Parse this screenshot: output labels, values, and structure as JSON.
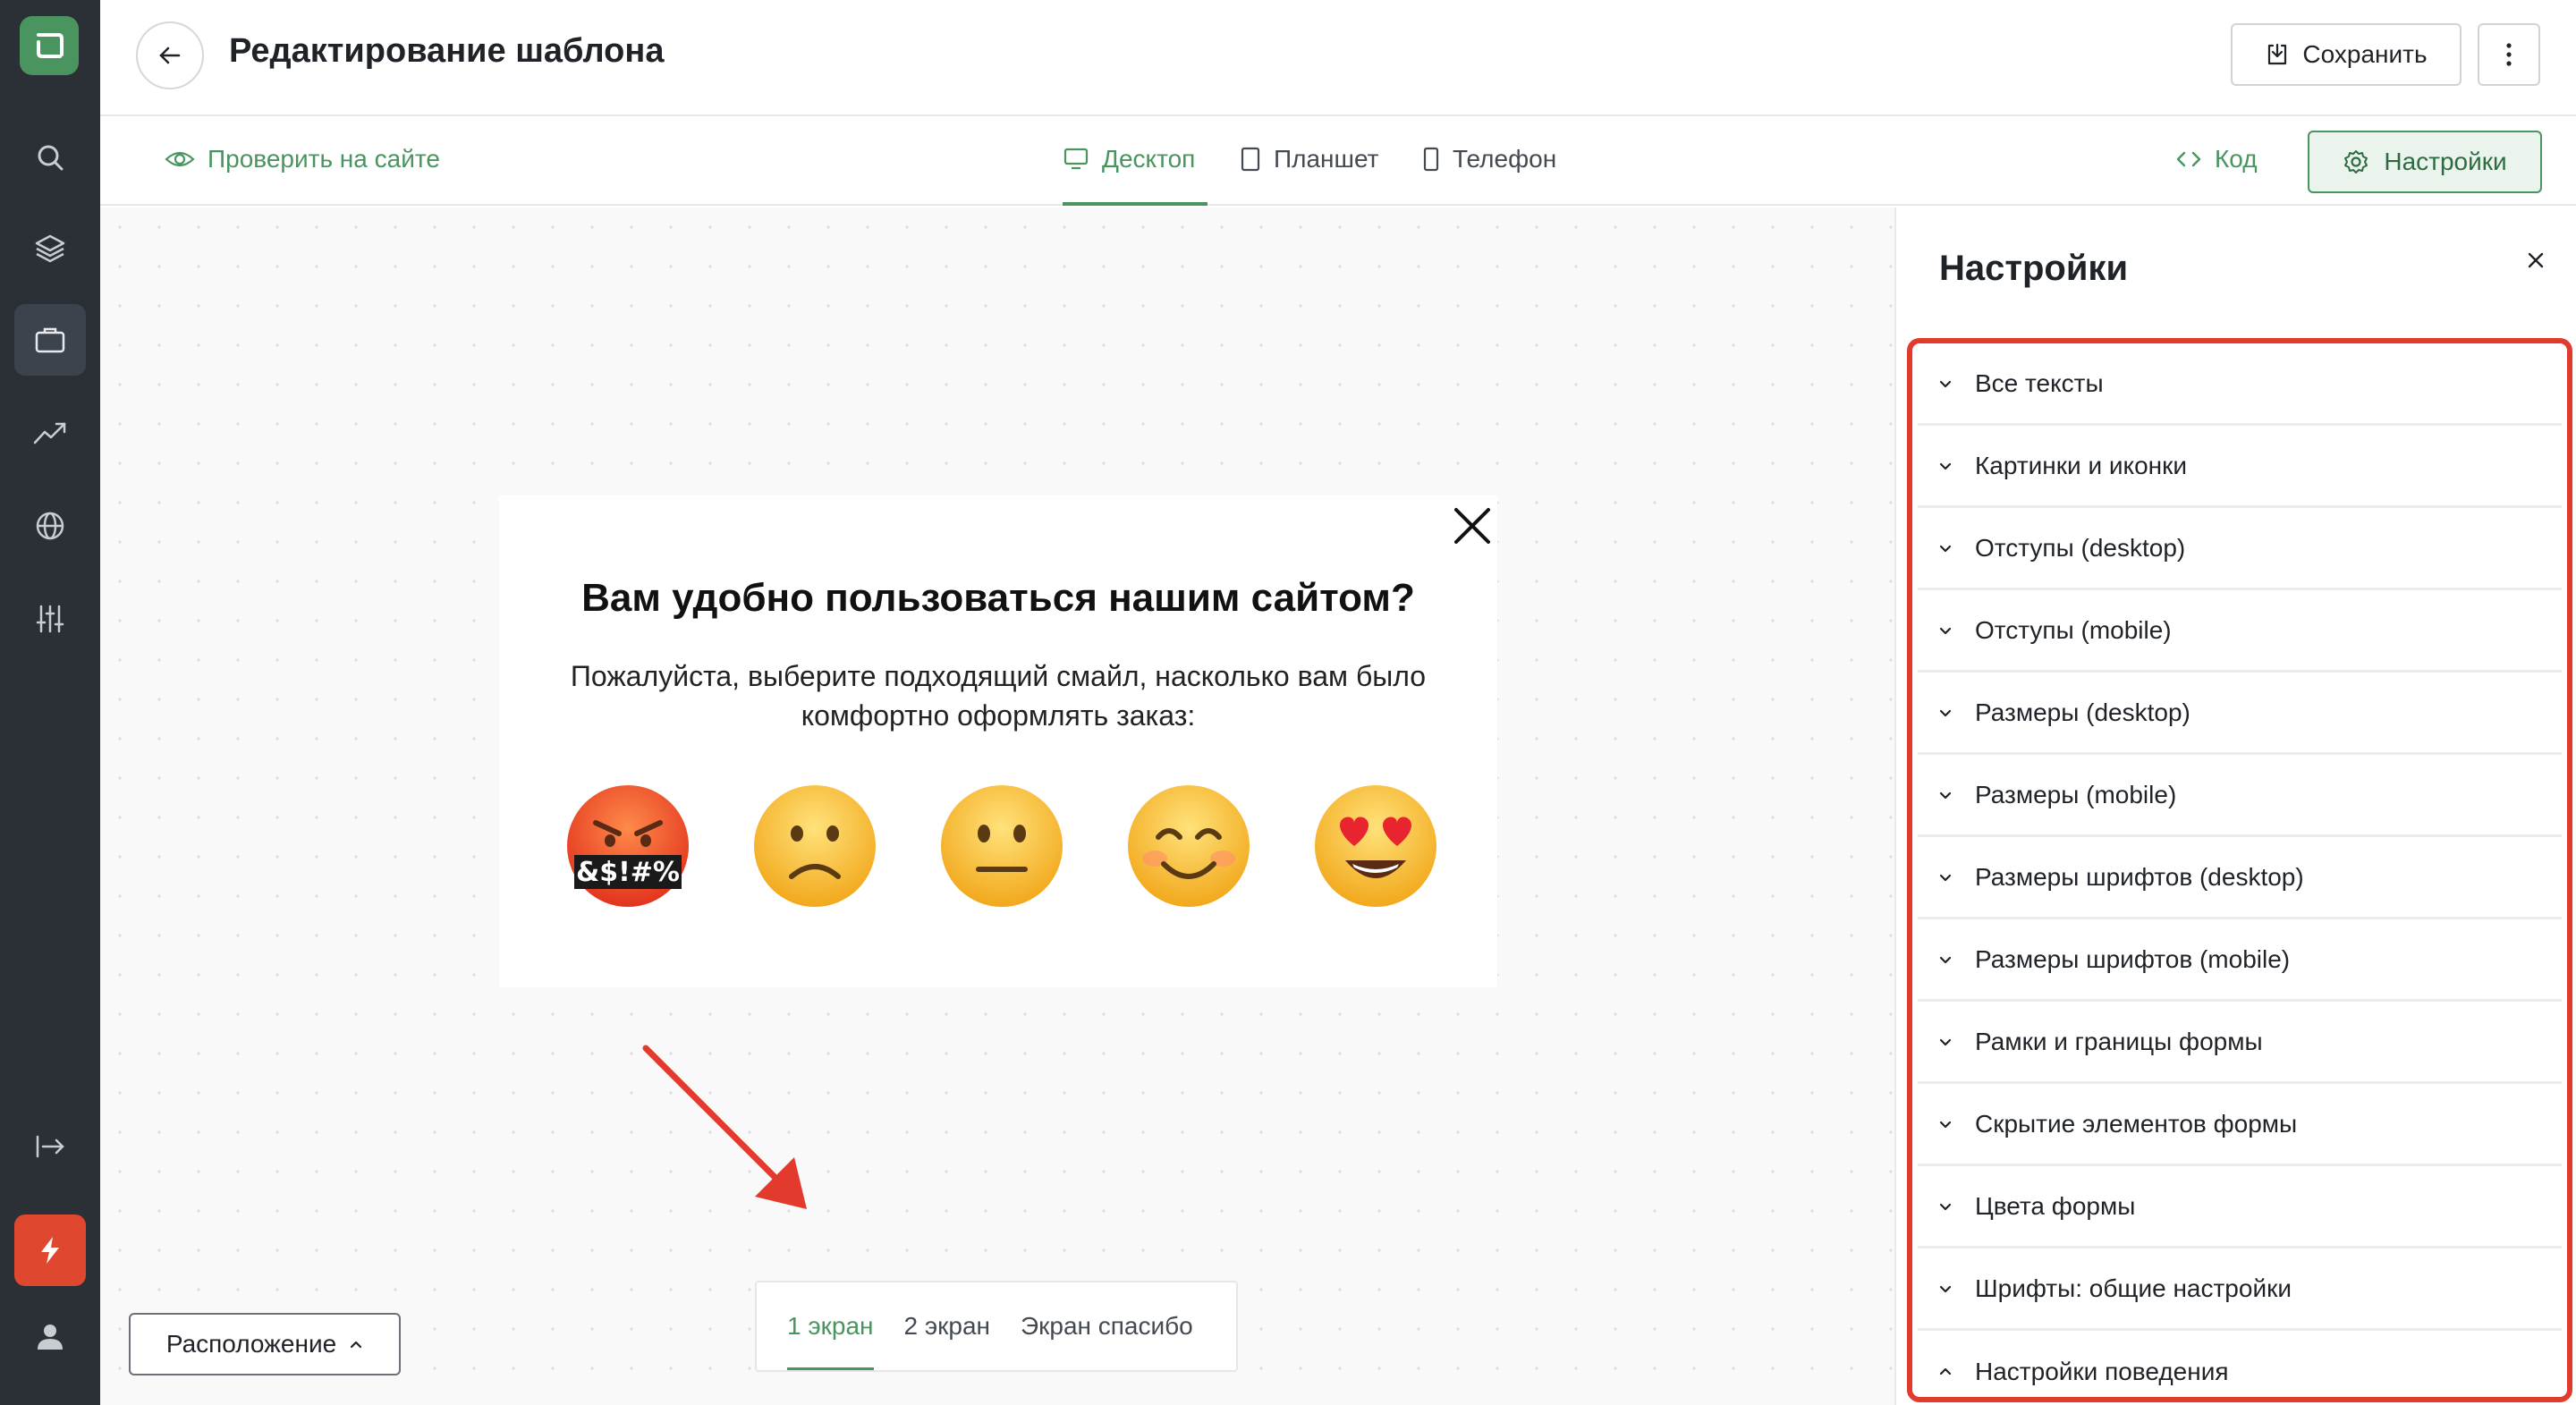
{
  "header": {
    "title": "Редактирование шаблона",
    "save_label": "Сохранить"
  },
  "toolbar": {
    "check_site": "Проверить на сайте",
    "devices": [
      "Десктоп",
      "Планшет",
      "Телефон"
    ],
    "active_device": "Десктоп",
    "code_label": "Код",
    "settings_label": "Настройки"
  },
  "popup": {
    "title": "Вам удобно пользоваться нашим сайтом?",
    "text": "Пожалуйста, выберите подходящий смайл, насколько вам было комфортно оформлять заказ:",
    "emoji_censor_text": "&$!#%",
    "emojis": [
      "angry-cursing-emoji",
      "frowning-emoji",
      "neutral-emoji",
      "smiling-emoji",
      "heart-eyes-emoji"
    ]
  },
  "screens": {
    "tabs": [
      "1 экран",
      "2 экран",
      "Экран спасибо"
    ],
    "active": "1 экран"
  },
  "position_label": "Расположение",
  "panel": {
    "title": "Настройки",
    "items": [
      "Все тексты",
      "Картинки и иконки",
      "Отступы (desktop)",
      "Отступы (mobile)",
      "Размеры (desktop)",
      "Размеры (mobile)",
      "Размеры шрифтов (desktop)",
      "Размеры шрифтов (mobile)",
      "Рамки и границы формы",
      "Скрытие элементов формы",
      "Цвета формы",
      "Шрифты: общие настройки",
      "Настройки поведения"
    ],
    "expanded_item": "Настройки поведения"
  },
  "colors": {
    "accent": "#4a9460",
    "rail": "#2b2f36",
    "highlight": "#e23a2c",
    "bolt": "#e0472f"
  }
}
